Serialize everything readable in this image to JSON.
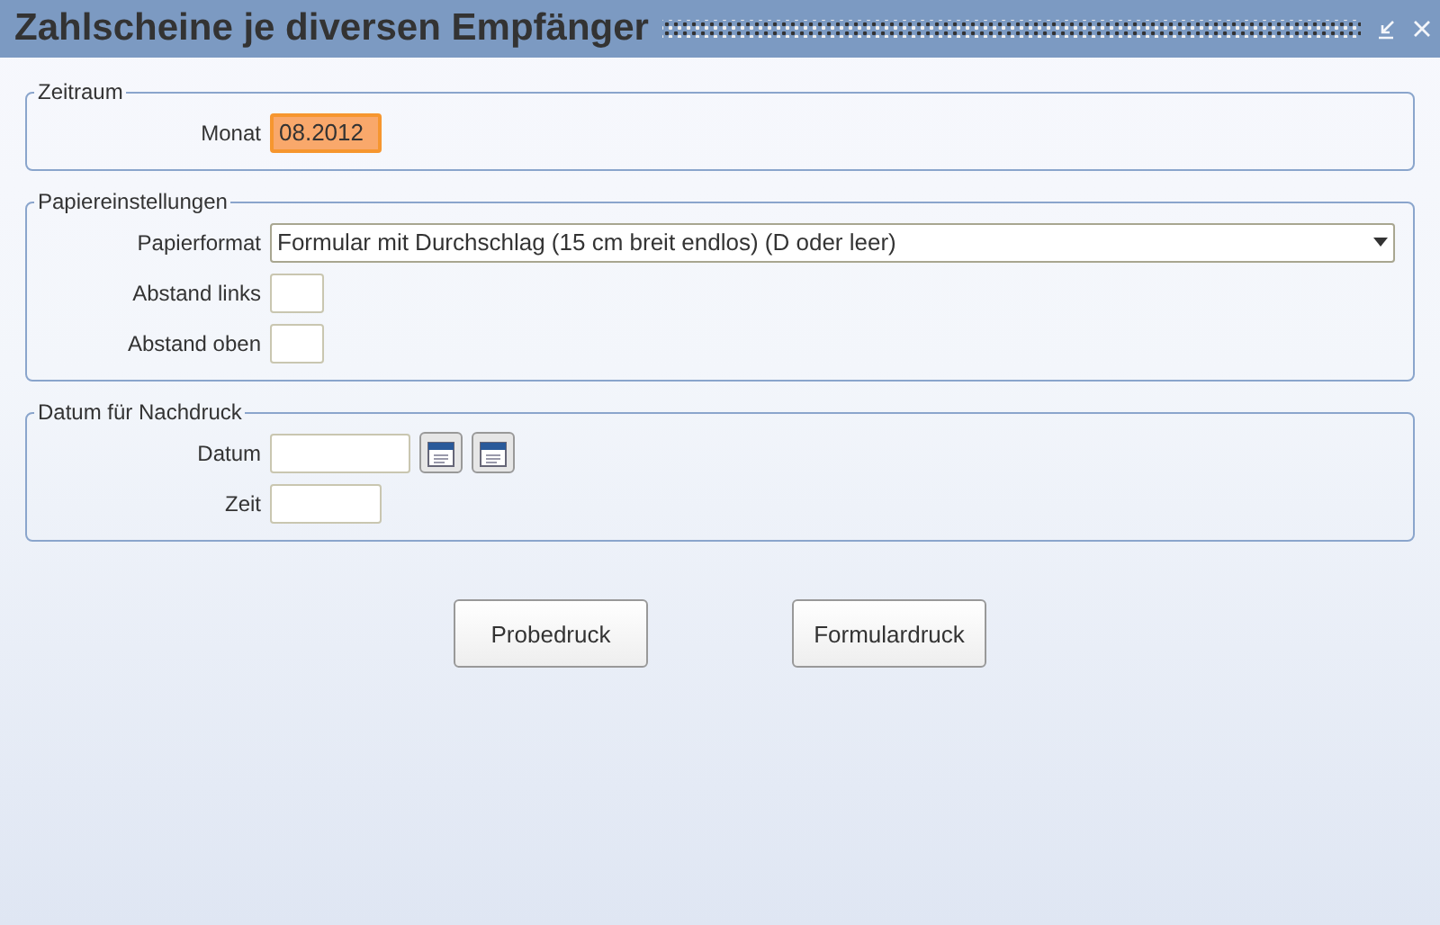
{
  "window": {
    "title": "Zahlscheine je diversen Empfänger"
  },
  "sections": [
    {
      "title": "Zeitraum",
      "fields": [
        {
          "label": "Monat",
          "kind": "text",
          "value": "08.2012",
          "focused": true
        }
      ]
    },
    {
      "title": "Papiereinstellungen",
      "fields": [
        {
          "label": "Papierformat",
          "kind": "select",
          "value": "Formular mit Durchschlag (15 cm breit endlos) (D oder leer)",
          "focused": false
        },
        {
          "label": "Abstand links",
          "kind": "text",
          "focused": false
        },
        {
          "label": "Abstand oben",
          "kind": "text",
          "focused": false
        }
      ]
    },
    {
      "title": "Datum für Nachdruck",
      "fields": [
        {
          "label": "Datum",
          "kind": "date",
          "focused": false
        },
        {
          "label": "Zeit",
          "kind": "text",
          "focused": false
        }
      ]
    }
  ],
  "buttons": [
    "Probedruck",
    "Formulardruck"
  ]
}
